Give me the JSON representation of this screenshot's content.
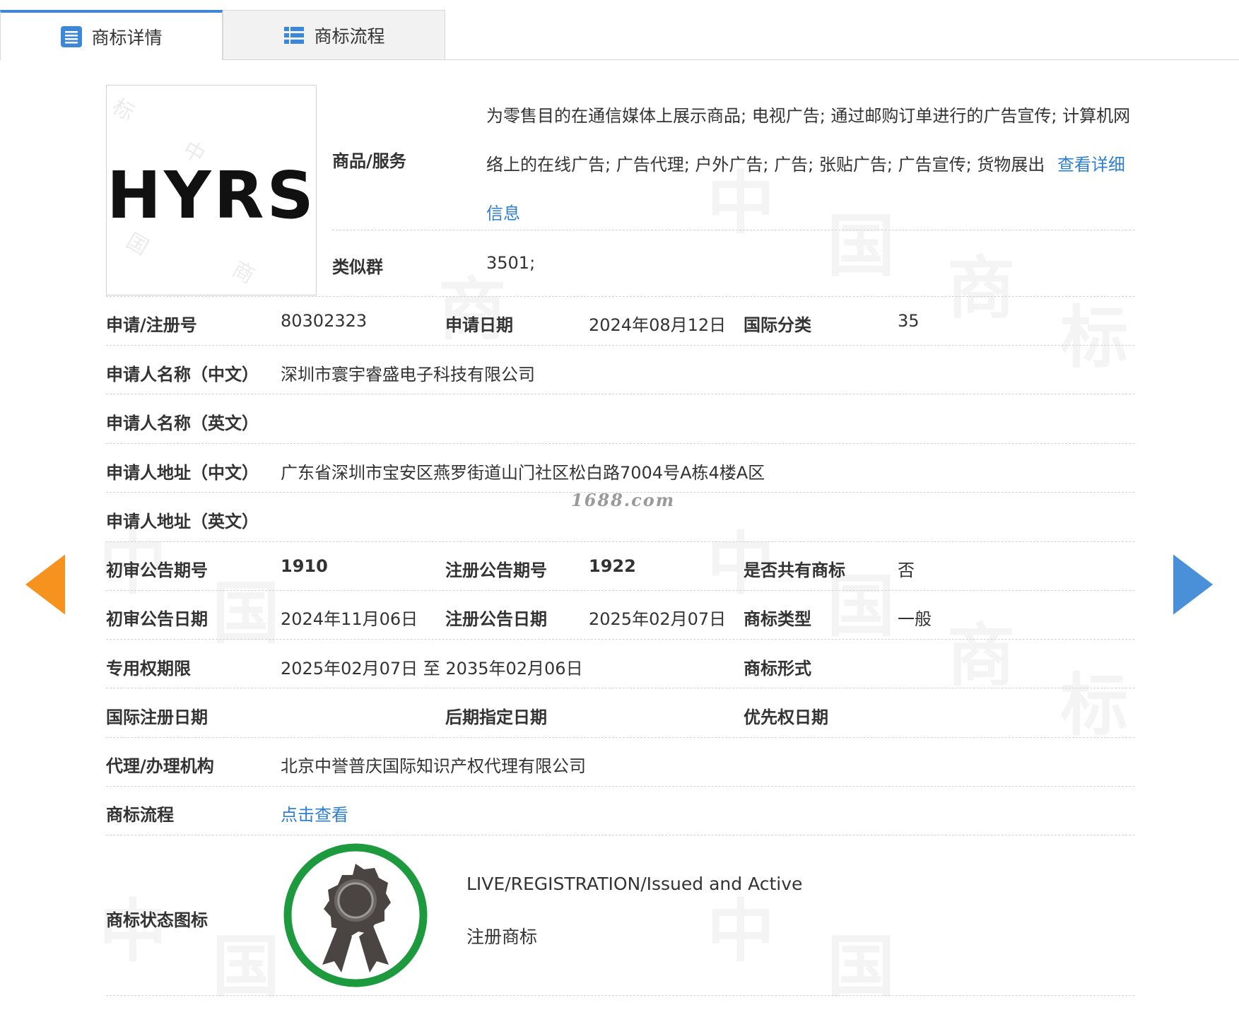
{
  "tabs": [
    {
      "label": "商标详情",
      "active": true,
      "icon": "list-doc-icon"
    },
    {
      "label": "商标流程",
      "active": false,
      "icon": "list-grid-icon"
    }
  ],
  "watermark": {
    "site": "1688.com",
    "chars": [
      "中",
      "国",
      "商",
      "标"
    ]
  },
  "logo": {
    "text": "HYRS"
  },
  "goods": {
    "label": "商品/服务",
    "text": "为零售目的在通信媒体上展示商品; 电视广告; 通过邮购订单进行的广告宣传; 计算机网络上的在线广告; 广告代理; 户外广告; 广告; 张贴广告; 广告宣传; 货物展出",
    "more_link": "查看详细信息"
  },
  "similar_group": {
    "label": "类似群",
    "value": "3501;"
  },
  "fields": {
    "reg_no": {
      "label": "申请/注册号",
      "value": "80302323"
    },
    "apply_date": {
      "label": "申请日期",
      "value": "2024年08月12日"
    },
    "intl_class": {
      "label": "国际分类",
      "value": "35"
    },
    "applicant_cn": {
      "label": "申请人名称（中文）",
      "value": "深圳市寰宇睿盛电子科技有限公司"
    },
    "applicant_en": {
      "label": "申请人名称（英文）",
      "value": ""
    },
    "address_cn": {
      "label": "申请人地址（中文）",
      "value": "广东省深圳市宝安区燕罗街道山门社区松白路7004号A栋4楼A区"
    },
    "address_en": {
      "label": "申请人地址（英文）",
      "value": ""
    },
    "prelim_issue": {
      "label": "初审公告期号",
      "value": "1910"
    },
    "reg_issue": {
      "label": "注册公告期号",
      "value": "1922"
    },
    "shared": {
      "label": "是否共有商标",
      "value": "否"
    },
    "prelim_date": {
      "label": "初审公告日期",
      "value": "2024年11月06日"
    },
    "reg_date": {
      "label": "注册公告日期",
      "value": "2025年02月07日"
    },
    "mark_type": {
      "label": "商标类型",
      "value": "一般"
    },
    "exclusive_period": {
      "label": "专用权期限",
      "value": "2025年02月07日 至 2035年02月06日"
    },
    "mark_form": {
      "label": "商标形式",
      "value": ""
    },
    "intl_reg_date": {
      "label": "国际注册日期",
      "value": ""
    },
    "later_date": {
      "label": "后期指定日期",
      "value": ""
    },
    "priority_date": {
      "label": "优先权日期",
      "value": ""
    },
    "agency": {
      "label": "代理/办理机构",
      "value": "北京中誉普庆国际知识产权代理有限公司"
    },
    "process": {
      "label": "商标流程",
      "value": "点击查看"
    }
  },
  "status": {
    "label": "商标状态图标",
    "line1": "LIVE/REGISTRATION/Issued and Active",
    "line2": "注册商标",
    "ring_color": "#1e9a3e",
    "icon": "award-ribbon-icon"
  },
  "colors": {
    "accent": "#3c87d8",
    "link": "#2f7fd1",
    "arrow_left": "#f5931e",
    "arrow_right": "#4a90d9"
  }
}
